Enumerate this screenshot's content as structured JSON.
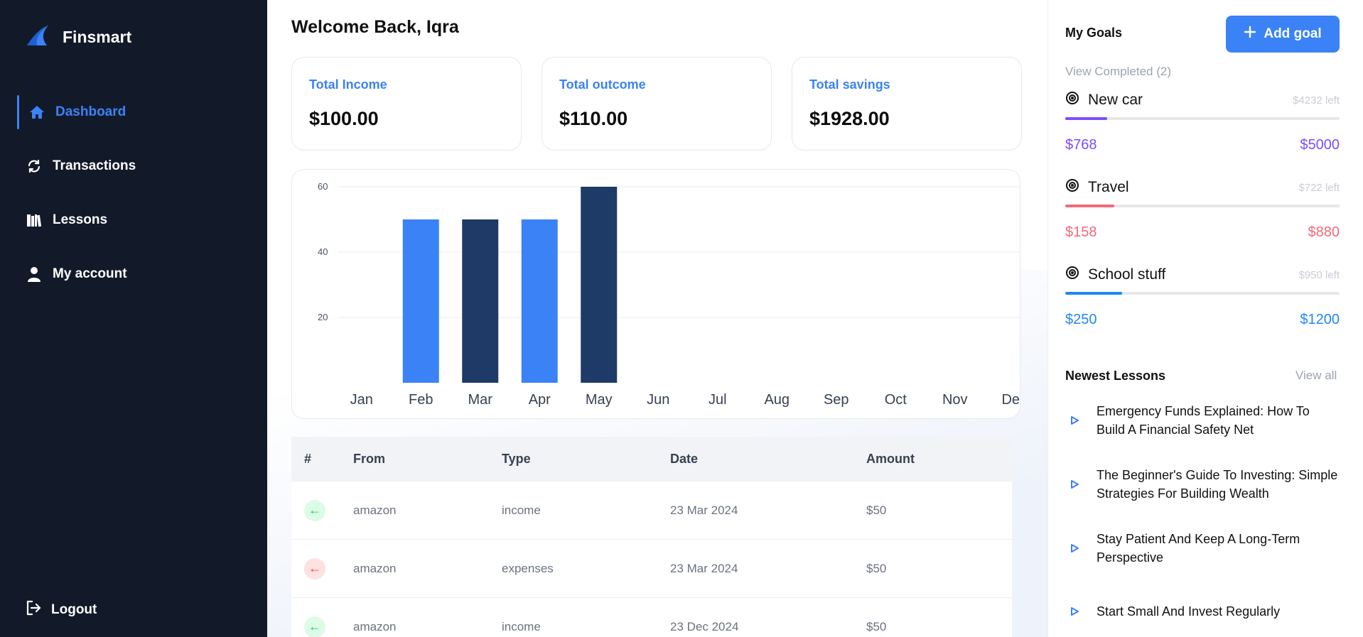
{
  "brand": {
    "name": "Finsmart",
    "accent": "#3b82f6"
  },
  "nav": {
    "items": [
      {
        "label": "Dashboard",
        "icon": "home-icon",
        "active": true
      },
      {
        "label": "Transactions",
        "icon": "refresh-icon",
        "active": false
      },
      {
        "label": "Lessons",
        "icon": "books-icon",
        "active": false
      },
      {
        "label": "My account",
        "icon": "user-icon",
        "active": false
      }
    ],
    "logout": "Logout"
  },
  "main": {
    "welcome": "Welcome Back, Iqra",
    "cards": [
      {
        "label": "Total Income",
        "value": "$100.00"
      },
      {
        "label": "Total outcome",
        "value": "$110.00"
      },
      {
        "label": "Total savings",
        "value": "$1928.00"
      }
    ]
  },
  "chart_data": {
    "type": "bar",
    "categories": [
      "Jan",
      "Feb",
      "Mar",
      "Apr",
      "May",
      "Jun",
      "Jul",
      "Aug",
      "Sep",
      "Oct",
      "Nov",
      "Dec"
    ],
    "values": [
      0,
      50,
      50,
      50,
      60,
      0,
      0,
      0,
      0,
      0,
      0,
      0
    ],
    "bar_colors": [
      "#3b82f6",
      "#3b82f6",
      "#1e3a66",
      "#3b82f6",
      "#1e3a66",
      "#3b82f6",
      "#1e3a66",
      "#3b82f6",
      "#1e3a66",
      "#3b82f6",
      "#1e3a66",
      "#3b82f6"
    ],
    "ylim": [
      0,
      60
    ],
    "yticks": [
      20,
      40,
      60
    ],
    "grid": true,
    "title": "",
    "xlabel": "",
    "ylabel": ""
  },
  "table": {
    "headers": [
      "#",
      "From",
      "Type",
      "Date",
      "Amount"
    ],
    "rows": [
      {
        "direction": "in",
        "from": "amazon",
        "type": "income",
        "date": "23 Mar 2024",
        "amount": "$50"
      },
      {
        "direction": "out",
        "from": "amazon",
        "type": "expenses",
        "date": "23 Mar 2024",
        "amount": "$50"
      },
      {
        "direction": "in",
        "from": "amazon",
        "type": "income",
        "date": "23 Dec 2024",
        "amount": "$50"
      }
    ]
  },
  "goals": {
    "title": "My Goals",
    "add_label": "Add goal",
    "view_completed": "View Completed (2)",
    "items": [
      {
        "name": "New car",
        "left": "$4232 left",
        "current": "$768",
        "target": "$5000",
        "progress": 0.1536,
        "color": "#7c4dff"
      },
      {
        "name": "Travel",
        "left": "$722 left",
        "current": "$158",
        "target": "$880",
        "progress": 0.18,
        "color": "#f16a7a"
      },
      {
        "name": "School stuff",
        "left": "$950 left",
        "current": "$250",
        "target": "$1200",
        "progress": 0.208,
        "color": "#1e88f5"
      }
    ]
  },
  "lessons": {
    "title": "Newest Lessons",
    "view_all": "View all",
    "items": [
      {
        "title": "Emergency Funds Explained: How To Build A Financial Safety Net"
      },
      {
        "title": "The Beginner's Guide To Investing: Simple Strategies For Building Wealth"
      },
      {
        "title": "Stay Patient And Keep A Long-Term Perspective"
      },
      {
        "title": "Start Small And Invest Regularly"
      }
    ]
  }
}
